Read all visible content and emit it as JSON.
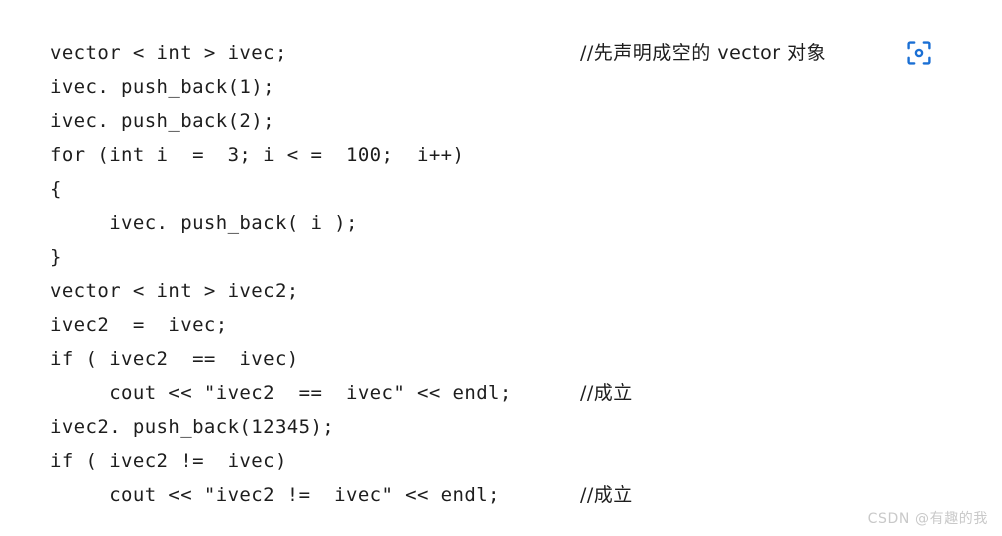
{
  "figure": {
    "background_color": "#ffffff",
    "text_color": "#1d1d1d",
    "accent_color": "#1a6fd4"
  },
  "code": {
    "language": "cpp",
    "lines": [
      {
        "text": "vector < int > ivec;",
        "comment": "//先声明成空的 vector 对象"
      },
      {
        "text": "ivec. push_back(1);",
        "comment": ""
      },
      {
        "text": "ivec. push_back(2);",
        "comment": ""
      },
      {
        "text": "for (int i  =  3; i < =  100;  i++)",
        "comment": ""
      },
      {
        "text": "{",
        "comment": ""
      },
      {
        "text": "     ivec. push_back( i );",
        "comment": ""
      },
      {
        "text": "}",
        "comment": ""
      },
      {
        "text": "vector < int > ivec2;",
        "comment": ""
      },
      {
        "text": "ivec2  =  ivec;",
        "comment": ""
      },
      {
        "text": "if ( ivec2  ==  ivec)",
        "comment": ""
      },
      {
        "text": "     cout << \"ivec2  ==  ivec\" << endl;",
        "comment": "//成立"
      },
      {
        "text": "ivec2. push_back(12345);",
        "comment": ""
      },
      {
        "text": "if ( ivec2 !=  ivec)",
        "comment": ""
      },
      {
        "text": "     cout << \"ivec2 !=  ivec\" << endl;",
        "comment": "//成立"
      }
    ]
  },
  "overlay": {
    "scan_icon_name": "scan-focus-icon",
    "scan_icon_color": "#1a6fd4"
  },
  "watermark": {
    "text": "CSDN @有趣的我"
  }
}
